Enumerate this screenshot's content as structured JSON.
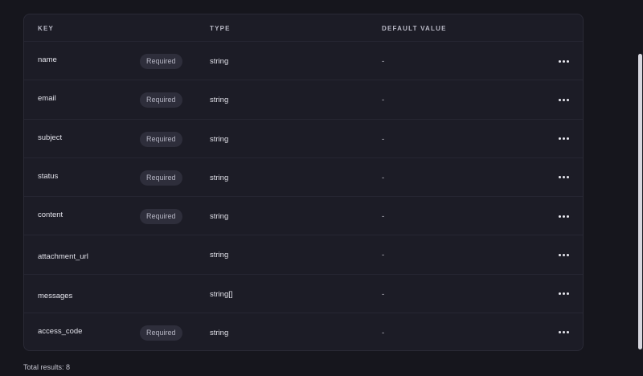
{
  "table": {
    "headers": {
      "key": "KEY",
      "type": "TYPE",
      "default": "DEFAULT VALUE"
    },
    "rows": [
      {
        "key": "name",
        "badge": "Required",
        "type": "string",
        "default": "-"
      },
      {
        "key": "email",
        "badge": "Required",
        "type": "string",
        "default": "-"
      },
      {
        "key": "subject",
        "badge": "Required",
        "type": "string",
        "default": "-"
      },
      {
        "key": "status",
        "badge": "Required",
        "type": "string",
        "default": "-"
      },
      {
        "key": "content",
        "badge": "Required",
        "type": "string",
        "default": "-"
      },
      {
        "key": "attachment_url",
        "badge": "",
        "type": "string",
        "default": "-"
      },
      {
        "key": "messages",
        "badge": "",
        "type": "string[]",
        "default": "-"
      },
      {
        "key": "access_code",
        "badge": "Required",
        "type": "string",
        "default": "-"
      }
    ],
    "row_action_icon": "more-horizontal-icon"
  },
  "footer": {
    "total_results": "Total results: 8"
  },
  "colors": {
    "background": "#16161d",
    "card": "#1c1c26",
    "badge": "#2e2e3b",
    "scrollbar_thumb": "#d6d6de"
  }
}
